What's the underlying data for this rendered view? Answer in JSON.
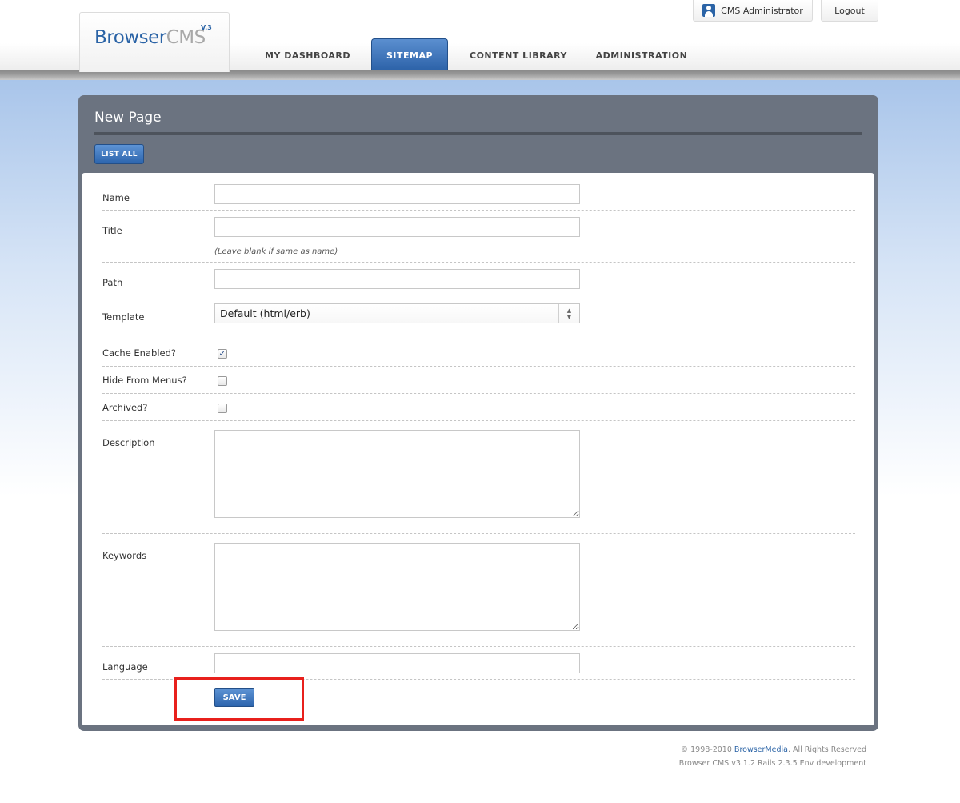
{
  "logo": {
    "brand": "Browser",
    "product": "CMS",
    "version": "V.3"
  },
  "user_menu": {
    "user_label": "CMS Administrator",
    "logout_label": "Logout"
  },
  "nav": {
    "tabs": [
      {
        "label": "MY DASHBOARD",
        "active": false
      },
      {
        "label": "SITEMAP",
        "active": true
      },
      {
        "label": "CONTENT LIBRARY",
        "active": false
      },
      {
        "label": "ADMINISTRATION",
        "active": false
      }
    ]
  },
  "page": {
    "title": "New Page",
    "list_all_label": "LIST ALL"
  },
  "form": {
    "name": {
      "label": "Name",
      "value": ""
    },
    "title": {
      "label": "Title",
      "value": "",
      "hint": "(Leave blank if same as name)"
    },
    "path": {
      "label": "Path",
      "value": ""
    },
    "template": {
      "label": "Template",
      "selected": "Default (html/erb)"
    },
    "cache_enabled": {
      "label": "Cache Enabled?",
      "checked": true
    },
    "hide_from_menus": {
      "label": "Hide From Menus?",
      "checked": false
    },
    "archived": {
      "label": "Archived?",
      "checked": false
    },
    "description": {
      "label": "Description",
      "value": ""
    },
    "keywords": {
      "label": "Keywords",
      "value": ""
    },
    "language": {
      "label": "Language",
      "value": ""
    },
    "save_label": "SAVE"
  },
  "footer": {
    "copyright_prefix": "© 1998-2010 ",
    "company": "BrowserMedia",
    "copyright_suffix": ". All Rights Reserved",
    "version_line": "Browser CMS v3.1.2 Rails 2.3.5 Env development"
  },
  "colors": {
    "accent": "#2a63a6",
    "panel": "#6b7380",
    "highlight": "#e8201c"
  }
}
